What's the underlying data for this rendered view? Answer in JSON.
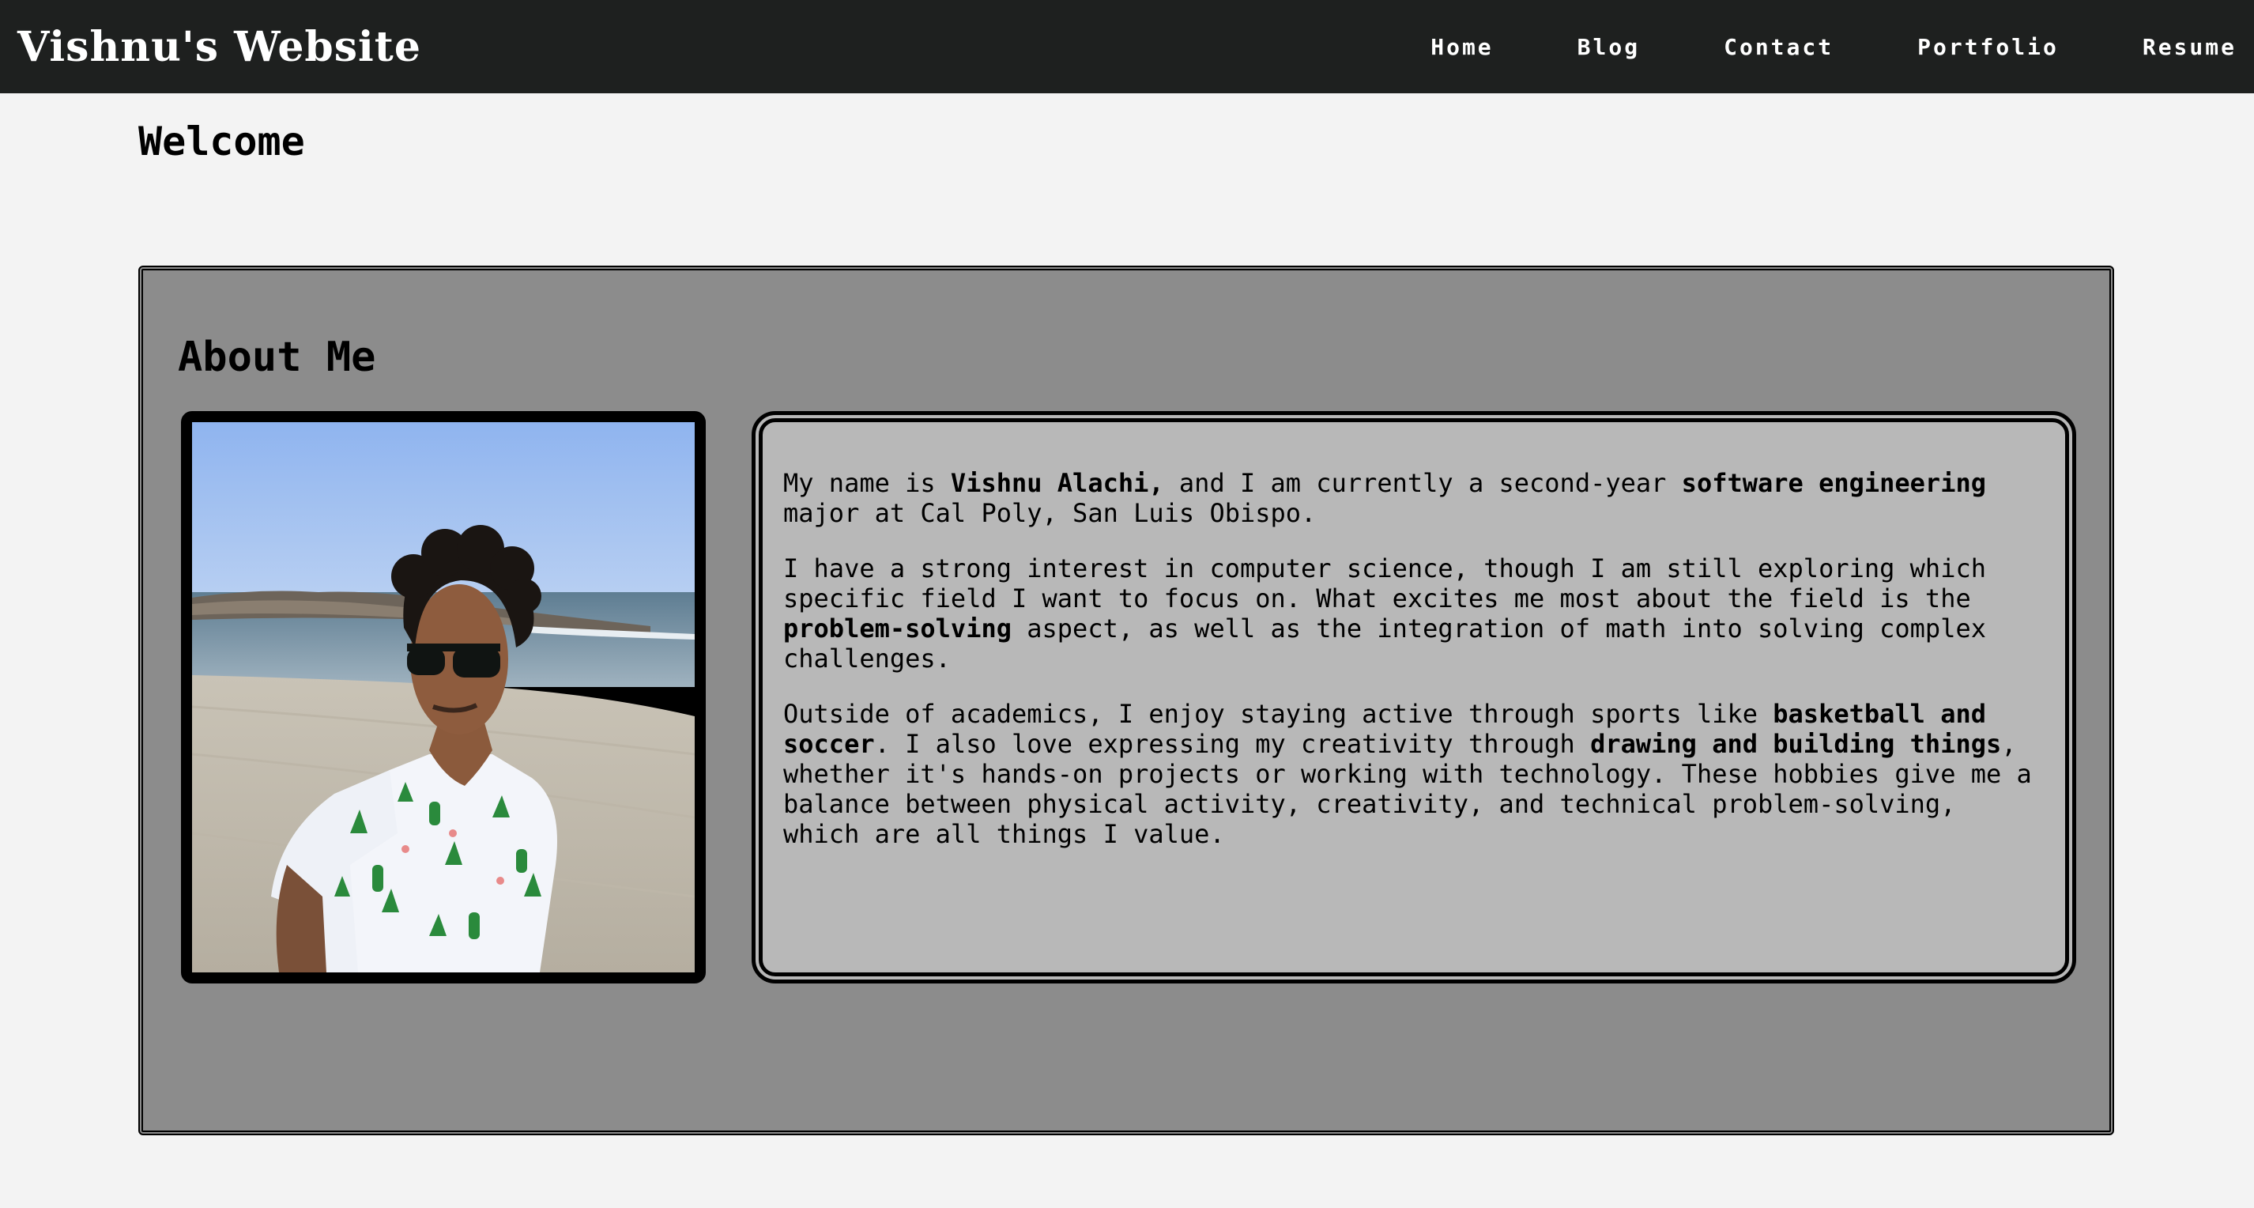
{
  "header": {
    "site_title": "Vishnu's Website",
    "nav": [
      "Home",
      "Blog",
      "Contact",
      "Portfolio",
      "Resume"
    ]
  },
  "main": {
    "page_title": "Welcome",
    "about": {
      "heading": "About Me",
      "photo_alt": "Photo of Vishnu on a beach",
      "paragraphs": [
        [
          {
            "t": "My name is ",
            "b": false
          },
          {
            "t": "Vishnu Alachi,",
            "b": true
          },
          {
            "t": " and I am currently a second-year ",
            "b": false
          },
          {
            "t": "software engineering",
            "b": true
          },
          {
            "t": " major at Cal Poly, San Luis Obispo.",
            "b": false
          }
        ],
        [
          {
            "t": "I have a strong interest in computer science, though I am still exploring which specific field I want to focus on. What excites me most about the field is the ",
            "b": false
          },
          {
            "t": "problem-solving",
            "b": true
          },
          {
            "t": " aspect, as well as the integration of math into solving complex challenges.",
            "b": false
          }
        ],
        [
          {
            "t": "Outside of academics, I enjoy staying active through sports like ",
            "b": false
          },
          {
            "t": "basketball and soccer",
            "b": true
          },
          {
            "t": ". I also love expressing my creativity through ",
            "b": false
          },
          {
            "t": "drawing and building things",
            "b": true
          },
          {
            "t": ", whether it's hands-on projects or working with technology. These hobbies give me a balance between physical activity, creativity, and technical problem-solving, which are all things I value.",
            "b": false
          }
        ]
      ]
    }
  },
  "colors": {
    "navbar": "#1e201f",
    "page_bg": "#f3f3f3",
    "panel_bg": "#8c8c8c",
    "bio_bg": "#b8b8b8"
  }
}
